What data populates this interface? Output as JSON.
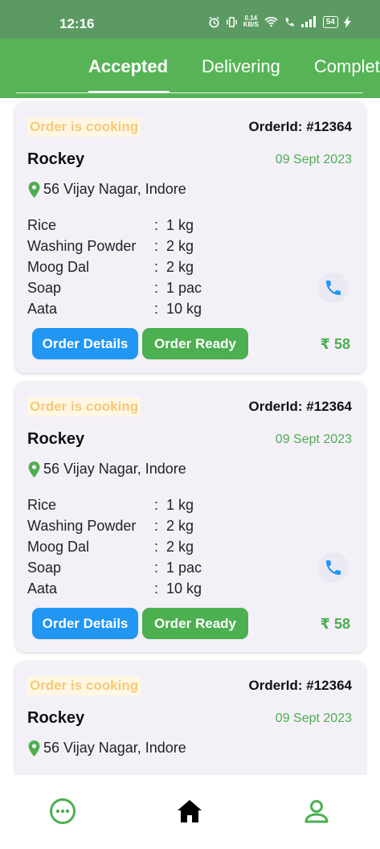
{
  "status_bar": {
    "time": "12:16",
    "net_speed_value": "0.14",
    "net_speed_unit": "KB/S",
    "battery": "54"
  },
  "tabs": [
    {
      "label": "Accepted",
      "active": true
    },
    {
      "label": "Delivering",
      "active": false
    },
    {
      "label": "Completed",
      "active": false
    }
  ],
  "orders": [
    {
      "status": "Order is cooking",
      "order_id": "OrderId: #12364",
      "customer": "Rockey",
      "date": "09 Sept 2023",
      "address": "56 Vijay Nagar, Indore",
      "items": [
        {
          "name": "Rice",
          "colon": ":",
          "qty": "1 kg"
        },
        {
          "name": "Washing Powder",
          "colon": ":",
          "qty": "2 kg"
        },
        {
          "name": "Moog Dal",
          "colon": ":",
          "qty": "2 kg"
        },
        {
          "name": "Soap",
          "colon": ":",
          "qty": "1 pac"
        },
        {
          "name": "Aata",
          "colon": ":",
          "qty": "10 kg"
        }
      ],
      "details_label": "Order Details",
      "ready_label": "Order Ready",
      "price": "₹ 58"
    },
    {
      "status": "Order is cooking",
      "order_id": "OrderId: #12364",
      "customer": "Rockey",
      "date": "09 Sept 2023",
      "address": "56 Vijay Nagar, Indore",
      "items": [
        {
          "name": "Rice",
          "colon": ":",
          "qty": "1 kg"
        },
        {
          "name": "Washing Powder",
          "colon": ":",
          "qty": "2 kg"
        },
        {
          "name": "Moog Dal",
          "colon": ":",
          "qty": "2 kg"
        },
        {
          "name": "Soap",
          "colon": ":",
          "qty": "1 pac"
        },
        {
          "name": "Aata",
          "colon": ":",
          "qty": "10 kg"
        }
      ],
      "details_label": "Order Details",
      "ready_label": "Order Ready",
      "price": "₹ 58"
    },
    {
      "status": "Order is cooking",
      "order_id": "OrderId: #12364",
      "customer": "Rockey",
      "date": "09 Sept 2023",
      "address": "56 Vijay Nagar, Indore"
    }
  ],
  "bottom_nav": [
    {
      "icon": "more-circle-icon"
    },
    {
      "icon": "home-icon"
    },
    {
      "icon": "profile-icon"
    }
  ],
  "colors": {
    "header_green": "#56b456",
    "status_bar": "#5c9a63",
    "accent_green": "#4caf50",
    "details_blue": "#2196f3",
    "cooking_amber": "#f5c97a",
    "card_bg": "#f4f0f8"
  }
}
